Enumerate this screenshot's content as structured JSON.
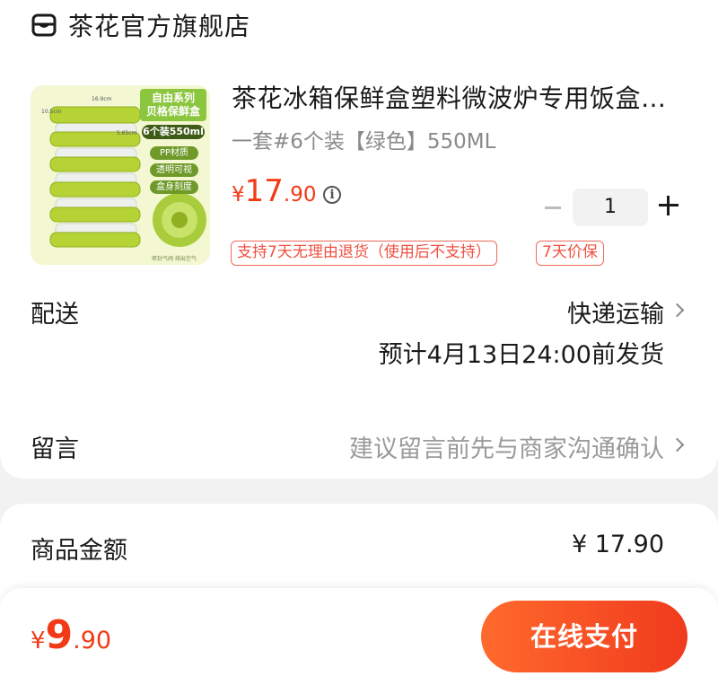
{
  "store": {
    "name": "茶花官方旗舰店",
    "icon": "store-icon"
  },
  "product": {
    "title": "茶花冰箱保鲜盒塑料微波炉专用饭盒…",
    "spec": "一套#6个装【绿色】550ML",
    "price": {
      "symbol": "¥",
      "int": "17",
      "dec": ".90"
    },
    "quantity": "1",
    "image": {
      "badge_line1": "自由系列",
      "badge_line2": "贝格保鲜盒",
      "pack": "6个装550ml",
      "features": [
        "PP材质",
        "透明可视",
        "盒身刻度"
      ],
      "dim_a": "10.5cm",
      "dim_b": "16.9cm",
      "dim_c": "5.65cm",
      "footnote": "密封气阀  排出空气"
    },
    "tags": [
      "支持7天无理由退货（使用后不支持）",
      "7天价保"
    ]
  },
  "delivery": {
    "label": "配送",
    "method": "快递运输",
    "eta": "预计4月13日24:00前发货"
  },
  "message": {
    "label": "留言",
    "placeholder": "建议留言前先与商家沟通确认"
  },
  "summary": {
    "goods_label": "商品金额",
    "goods_amount": "¥ 17.90"
  },
  "footer": {
    "total": {
      "symbol": "¥",
      "int": "9",
      "dec": ".90"
    },
    "pay_label": "在线支付"
  },
  "colors": {
    "accent": "#f23a16",
    "product_green": "#b5d334"
  }
}
